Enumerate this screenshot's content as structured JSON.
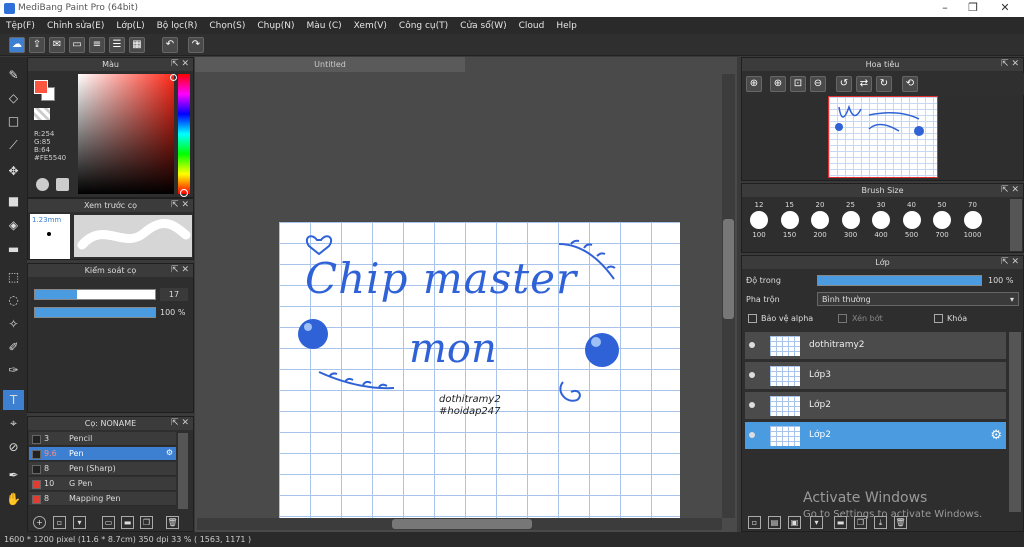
{
  "window": {
    "title": "MediBang Paint Pro (64bit)"
  },
  "menu": [
    "Tệp(F)",
    "Chỉnh sửa(E)",
    "Lớp(L)",
    "Bộ lọc(R)",
    "Chọn(S)",
    "Chụp(N)",
    "Màu (C)",
    "Xem(V)",
    "Công cụ(T)",
    "Cửa sổ(W)",
    "Cloud",
    "Help"
  ],
  "color_panel": {
    "title": "Màu",
    "r": "R:254",
    "g": "G:85",
    "b": "B:64",
    "hex": "#FE5540",
    "fg_color": "#fe5540"
  },
  "brush_preview": {
    "title": "Xem trước cọ",
    "size": "1.23mm"
  },
  "brush_control": {
    "title": "Kiểm soát cọ",
    "size_value": "17",
    "opacity_value": "100 %",
    "size_fraction": 0.35,
    "opacity_fraction": 1.0
  },
  "brush_list": {
    "title": "Cọ: NONAME",
    "items": [
      {
        "size": "3",
        "name": "Pencil",
        "color": "#222222",
        "selected": false
      },
      {
        "size": "9.6",
        "name": "Pen",
        "color": "#222222",
        "selected": true
      },
      {
        "size": "8",
        "name": "Pen (Sharp)",
        "color": "#222222",
        "selected": false
      },
      {
        "size": "10",
        "name": "G Pen",
        "color": "#e53a2f",
        "selected": false
      },
      {
        "size": "8",
        "name": "Mapping Pen",
        "color": "#e53a2f",
        "selected": false
      }
    ]
  },
  "document": {
    "tab": "Untitled"
  },
  "artwork": {
    "line1": "Chip master",
    "line2": "mon",
    "caption1": "dothitramy2",
    "caption2": "#hoidap247"
  },
  "navigator": {
    "title": "Hoa tiêu"
  },
  "brush_size": {
    "title": "Brush Size",
    "top": [
      "12",
      "15",
      "20",
      "25",
      "30",
      "40",
      "50",
      "70"
    ],
    "bottom": [
      "100",
      "150",
      "200",
      "300",
      "400",
      "500",
      "700",
      "1000"
    ]
  },
  "layer_panel": {
    "title": "Lớp",
    "opacity_label": "Độ trong",
    "opacity_value": "100 %",
    "blend_label": "Pha trộn",
    "blend_value": "Bình thường",
    "protect_alpha": "Bảo vệ alpha",
    "clipping": "Xén bớt",
    "lock": "Khóa",
    "layers": [
      {
        "name": "dothitramy2",
        "selected": false
      },
      {
        "name": "Lớp3",
        "selected": false
      },
      {
        "name": "Lớp2",
        "selected": false
      },
      {
        "name": "Lớp2",
        "selected": true
      }
    ]
  },
  "status": {
    "text": "1600 * 1200 pixel   (11.6 * 8.7cm)   350 dpi   33 %   ( 1563, 1171 )"
  },
  "watermark": {
    "line1": "Activate Windows",
    "line2": "Go to Settings to activate Windows."
  },
  "colors": {
    "accent": "#3d7fd1",
    "layer_selected": "#4a9be0",
    "ink": "#2f62d6"
  }
}
